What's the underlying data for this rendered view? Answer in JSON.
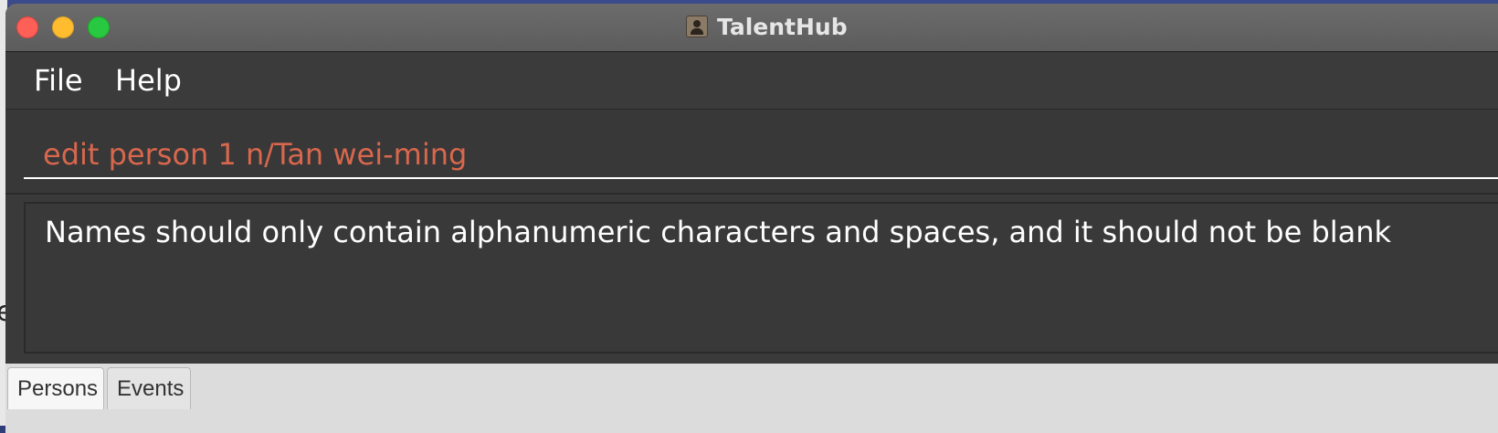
{
  "window": {
    "title": "TalentHub",
    "app_icon": "person-icon"
  },
  "menu": {
    "items": [
      {
        "label": "File"
      },
      {
        "label": "Help"
      }
    ]
  },
  "command": {
    "value": "edit person 1 n/Tan wei-ming",
    "text_color": "#d9674d"
  },
  "result": {
    "message": "Names should only contain alphanumeric characters and spaces, and it should not be blank"
  },
  "tabs": [
    {
      "label": "Persons",
      "selected": true
    },
    {
      "label": "Events",
      "selected": false
    }
  ],
  "colors": {
    "close": "#fe5f57",
    "minimize": "#febc2e",
    "maximize": "#28c840"
  }
}
